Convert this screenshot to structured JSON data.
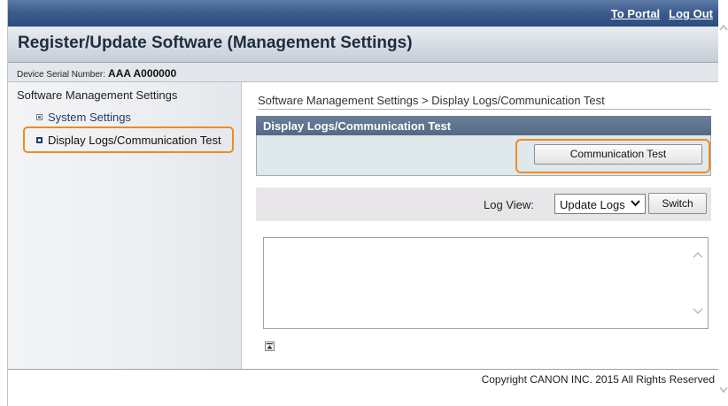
{
  "header": {
    "portal_link": "To Portal",
    "logout_link": "Log Out",
    "title": "Register/Update Software (Management Settings)"
  },
  "device": {
    "serial_label": "Device Serial Number:",
    "serial_value": "AAA A000000"
  },
  "sidebar": {
    "heading": "Software Management Settings",
    "items": [
      {
        "label": "System Settings",
        "active": false
      },
      {
        "label": "Display Logs/Communication Test",
        "active": true
      }
    ]
  },
  "main": {
    "breadcrumb": "Software Management Settings > Display Logs/Communication Test",
    "panel_title": "Display Logs/Communication Test",
    "comm_test_button": "Communication Test",
    "log_view_label": "Log View:",
    "log_view_selected": "Update Logs",
    "switch_button": "Switch"
  },
  "footer": {
    "copyright": "Copyright CANON INC. 2015 All Rights Reserved"
  },
  "colors": {
    "accent_highlight": "#f08a24",
    "topbar": "#3a5a8c",
    "panel_header": "#5e7490"
  },
  "icons": [
    "chevron-down-icon",
    "scroll-up-icon",
    "scroll-down-icon",
    "back-to-top-icon",
    "bullet-square-icon"
  ]
}
